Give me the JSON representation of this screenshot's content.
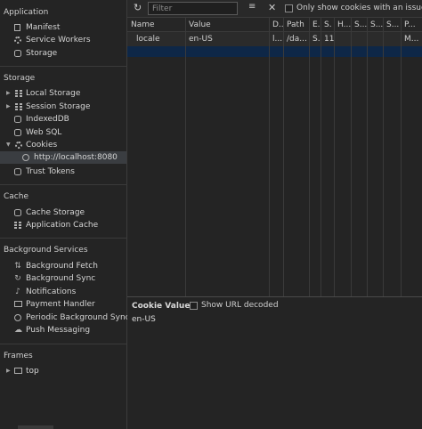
{
  "sidebar": {
    "application": {
      "title": "Application",
      "items": [
        {
          "label": "Manifest",
          "icon": "document-icon"
        },
        {
          "label": "Service Workers",
          "icon": "gear-icon"
        },
        {
          "label": "Storage",
          "icon": "database-icon"
        }
      ]
    },
    "storage": {
      "title": "Storage",
      "items": [
        {
          "label": "Local Storage",
          "icon": "grid-icon",
          "expandable": true
        },
        {
          "label": "Session Storage",
          "icon": "grid-icon",
          "expandable": true
        },
        {
          "label": "IndexedDB",
          "icon": "database-icon"
        },
        {
          "label": "Web SQL",
          "icon": "database-icon"
        },
        {
          "label": "Cookies",
          "icon": "cookie-icon",
          "expanded": true
        },
        {
          "label": "http://localhost:8080",
          "icon": "globe-icon",
          "selected": true
        },
        {
          "label": "Trust Tokens",
          "icon": "database-icon"
        }
      ]
    },
    "cache": {
      "title": "Cache",
      "items": [
        {
          "label": "Cache Storage",
          "icon": "database-icon"
        },
        {
          "label": "Application Cache",
          "icon": "grid-icon"
        }
      ]
    },
    "background_services": {
      "title": "Background Services",
      "items": [
        {
          "label": "Background Fetch",
          "icon": "arrows-icon"
        },
        {
          "label": "Background Sync",
          "icon": "sync-icon"
        },
        {
          "label": "Notifications",
          "icon": "bell-icon"
        },
        {
          "label": "Payment Handler",
          "icon": "card-icon"
        },
        {
          "label": "Periodic Background Sync",
          "icon": "clock-icon"
        },
        {
          "label": "Push Messaging",
          "icon": "cloud-icon"
        }
      ]
    },
    "frames": {
      "title": "Frames",
      "items": [
        {
          "label": "top",
          "icon": "frame-icon",
          "expandable": true
        }
      ]
    }
  },
  "toolbar": {
    "filter_placeholder": "Filter",
    "only_issue_label": "Only show cookies with an issue"
  },
  "cookie_table": {
    "columns": [
      "Name",
      "Value",
      "D...",
      "Path",
      "E.",
      "S.",
      "H...",
      "S...",
      "S...",
      "S...",
      "P..."
    ],
    "rows": [
      [
        "locale",
        "en-US",
        "l...",
        "/da...",
        "S...",
        "11",
        "",
        "",
        "",
        "",
        "M..."
      ]
    ]
  },
  "cookie_value_panel": {
    "title": "Cookie Value",
    "show_decoded_label": "Show URL decoded",
    "value": "en-US"
  },
  "colors": {
    "background": "#242424",
    "selected_row": "#0e2747",
    "selected_sidebar": "#3a3d41"
  }
}
